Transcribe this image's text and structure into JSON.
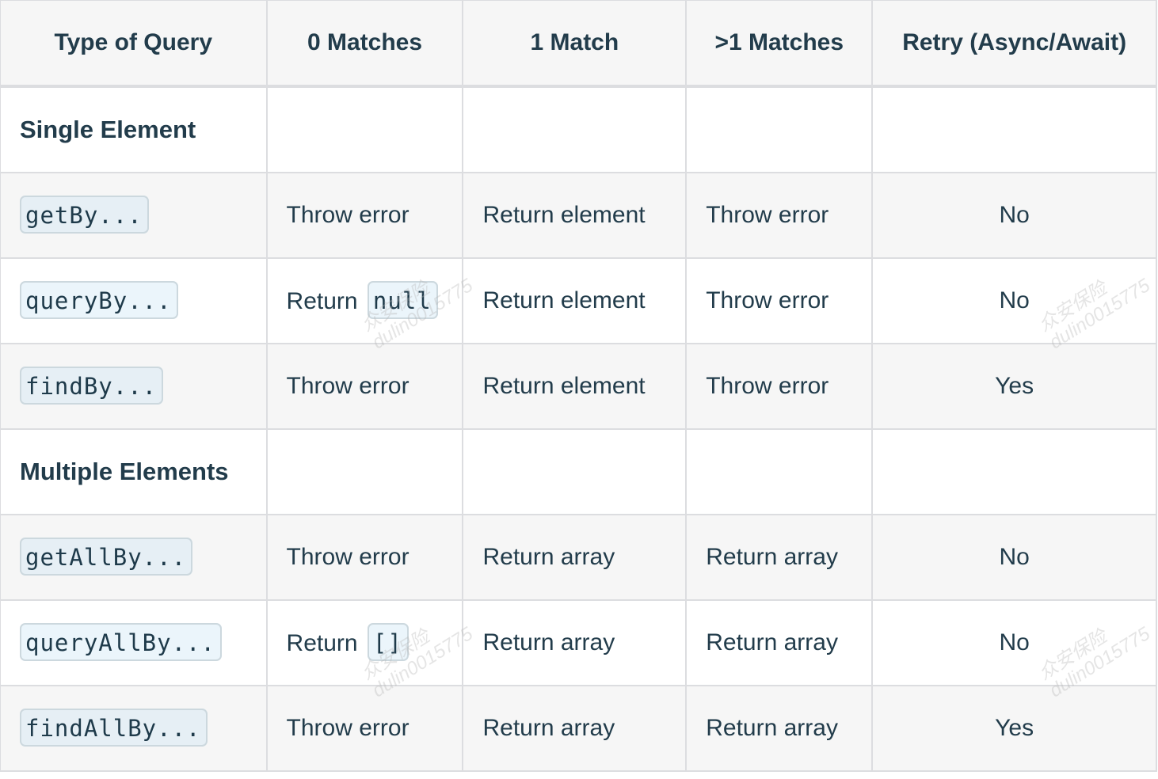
{
  "table": {
    "headers": [
      "Type of Query",
      "0 Matches",
      "1 Match",
      ">1 Matches",
      "Retry (Async/Await)"
    ],
    "sections": [
      {
        "title": "Single Element",
        "rows": [
          {
            "query": "getBy...",
            "zero": "Throw error",
            "zero_code": "",
            "one": "Return element",
            "many": "Throw error",
            "retry": "No"
          },
          {
            "query": "queryBy...",
            "zero": "Return",
            "zero_code": "null",
            "one": "Return element",
            "many": "Throw error",
            "retry": "No"
          },
          {
            "query": "findBy...",
            "zero": "Throw error",
            "zero_code": "",
            "one": "Return element",
            "many": "Throw error",
            "retry": "Yes"
          }
        ]
      },
      {
        "title": "Multiple Elements",
        "rows": [
          {
            "query": "getAllBy...",
            "zero": "Throw error",
            "zero_code": "",
            "one": "Return array",
            "many": "Return array",
            "retry": "No"
          },
          {
            "query": "queryAllBy...",
            "zero": "Return",
            "zero_code": "[]",
            "one": "Return array",
            "many": "Return array",
            "retry": "No"
          },
          {
            "query": "findAllBy...",
            "zero": "Throw error",
            "zero_code": "",
            "one": "Return array",
            "many": "Return array",
            "retry": "Yes"
          }
        ]
      }
    ]
  },
  "watermark": {
    "line1": "众安保险",
    "line2": "dulin0015775"
  }
}
